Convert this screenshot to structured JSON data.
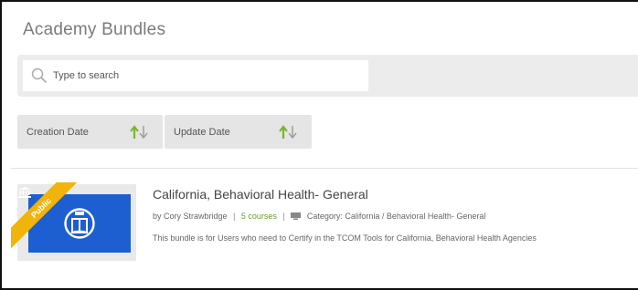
{
  "page": {
    "title": "Academy Bundles"
  },
  "search": {
    "placeholder": "Type to search",
    "value": ""
  },
  "sort": [
    {
      "label": "Creation Date"
    },
    {
      "label": "Update Date"
    }
  ],
  "colors": {
    "accent_green": "#6d9c2c",
    "thumb_blue": "#1d5fd0",
    "ribbon_gold": "#f0b40a"
  },
  "bundles": [
    {
      "badge": "Public",
      "title": "California, Behavioral Health- General",
      "author": "by Cory Strawbridge",
      "courses": "5 courses",
      "category": "Category: California / Behavioral Health- General",
      "description": "This bundle is for Users who need to Certify in the TCOM Tools for California, Behavioral Health Agencies",
      "icon": "open-book-icon"
    }
  ]
}
